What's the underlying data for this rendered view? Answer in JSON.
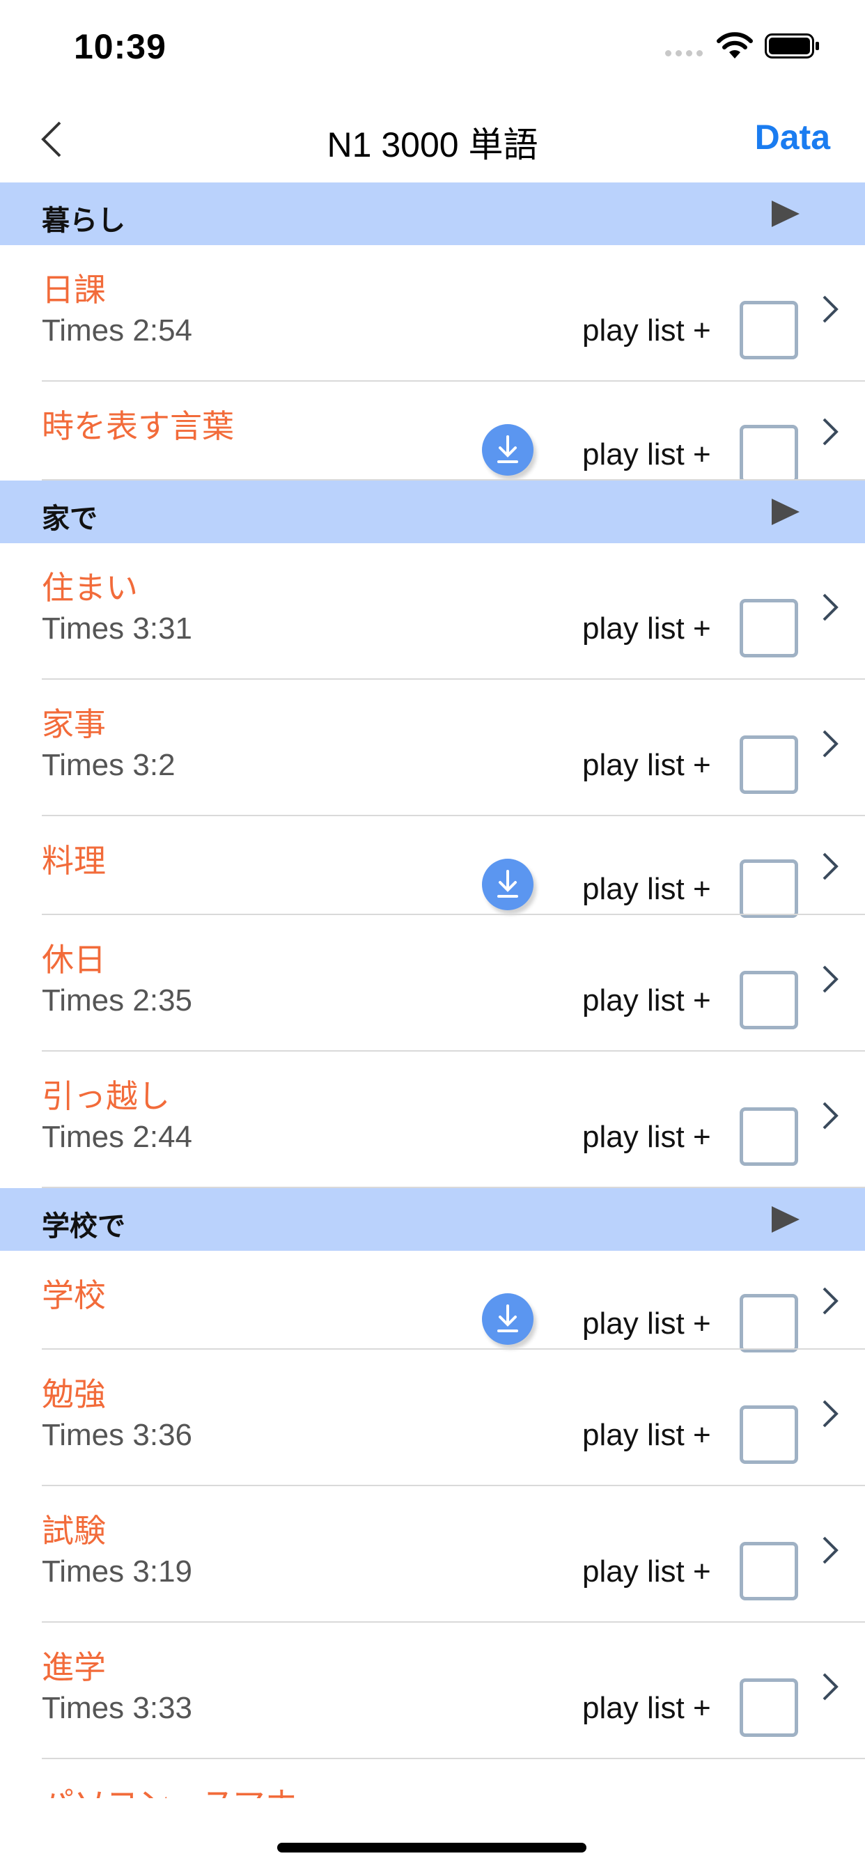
{
  "status_bar": {
    "time": "10:39"
  },
  "nav": {
    "title": "N1 3000 単語",
    "right_button": "Data"
  },
  "sections": [
    {
      "title": "暮らし",
      "rows": [
        {
          "title": "日課",
          "times": "Times  2:54",
          "playlist": "play list +",
          "downloaded": true
        },
        {
          "title": "時を表す言葉",
          "playlist": "play list +",
          "downloaded": false
        }
      ]
    },
    {
      "title": "家で",
      "rows": [
        {
          "title": "住まい",
          "times": "Times  3:31",
          "playlist": "play list +",
          "downloaded": true
        },
        {
          "title": "家事",
          "times": "Times  3:2",
          "playlist": "play list +",
          "downloaded": true
        },
        {
          "title": "料理",
          "playlist": "play list +",
          "downloaded": false
        },
        {
          "title": "休日",
          "times": "Times  2:35",
          "playlist": "play list +",
          "downloaded": true
        },
        {
          "title": "引っ越し",
          "times": "Times  2:44",
          "playlist": "play list +",
          "downloaded": true
        }
      ]
    },
    {
      "title": "学校で",
      "rows": [
        {
          "title": "学校",
          "playlist": "play list +",
          "downloaded": false
        },
        {
          "title": "勉強",
          "times": "Times  3:36",
          "playlist": "play list +",
          "downloaded": true
        },
        {
          "title": "試験",
          "times": "Times  3:19",
          "playlist": "play list +",
          "downloaded": true
        },
        {
          "title": "進学",
          "times": "Times  3:33",
          "playlist": "play list +",
          "downloaded": true
        },
        {
          "title": "パソコン・スマホ"
        }
      ]
    }
  ],
  "colors": {
    "accent": "#1a7cf0",
    "section_bg": "#bad2fc",
    "item_title": "#f26b3a",
    "download_badge": "#5b96f0"
  },
  "icons": [
    "back-chevron-icon",
    "play-icon",
    "download-icon",
    "chevron-right-icon",
    "wifi-icon",
    "battery-icon",
    "signal-icon"
  ]
}
